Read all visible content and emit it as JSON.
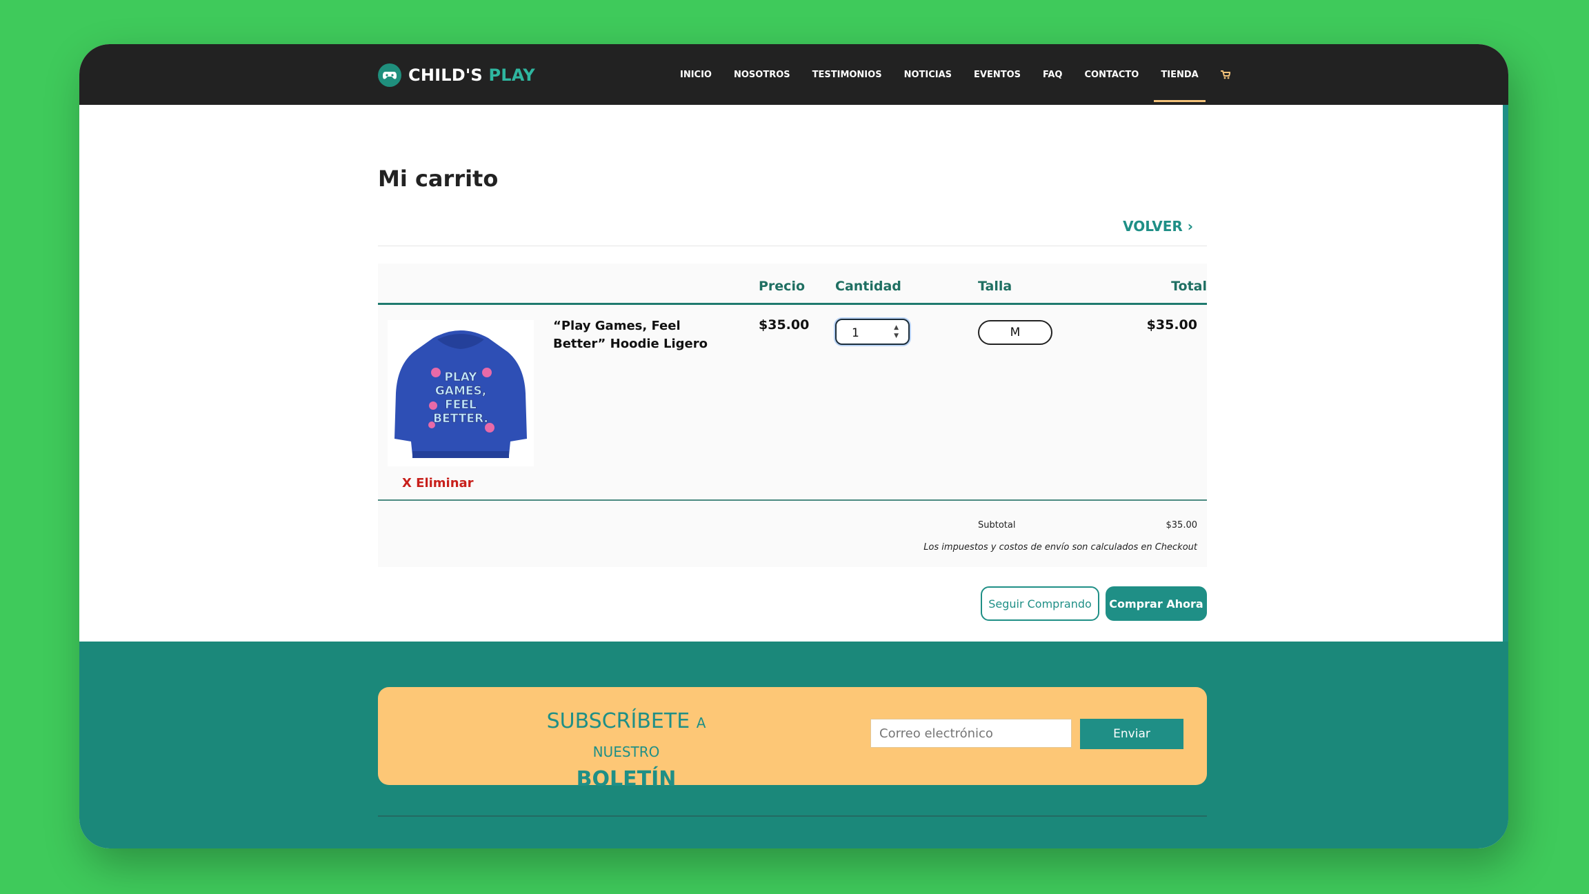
{
  "brand": {
    "name_primary": "CHILD'S",
    "name_accent": "PLAY",
    "logo_icon": "gamepad-icon"
  },
  "nav": {
    "items": [
      "INICIO",
      "NOSOTROS",
      "TESTIMONIOS",
      "NOTICIAS",
      "EVENTOS",
      "FAQ",
      "CONTACTO",
      "TIENDA"
    ],
    "active": "TIENDA",
    "cart_icon": "cart-icon",
    "accent_color": "#f3c27a"
  },
  "cart": {
    "title": "Mi carrito",
    "back_label": "VOLVER ›",
    "headers": {
      "price": "Precio",
      "quantity": "Cantidad",
      "size": "Talla",
      "total": "Total"
    },
    "item": {
      "name": "“Play Games, Feel Better” Hoodie Ligero",
      "price": "$35.00",
      "quantity": "1",
      "size": "M",
      "total": "$35.00",
      "remove_label": "X Eliminar",
      "image_text": "PLAY GAMES, FEEL BETTER"
    },
    "subtotal_label": "Subtotal",
    "subtotal_value": "$35.00",
    "tax_note": "Los impuestos y costos de envío son calculados en Checkout",
    "continue_label": "Seguir Comprando",
    "buy_label": "Comprar Ahora"
  },
  "newsletter": {
    "title_line1": "SUBSCRÍBETE",
    "title_a": "A",
    "title_nuestro": "NUESTRO",
    "title_bold": "BOLETÍN",
    "email_placeholder": "Correo electrónico",
    "submit_label": "Enviar"
  },
  "colors": {
    "teal": "#1f8f86",
    "dark": "#222222",
    "green_bg": "#3fca5b",
    "yellow": "#fdc776",
    "red": "#c8201c"
  }
}
